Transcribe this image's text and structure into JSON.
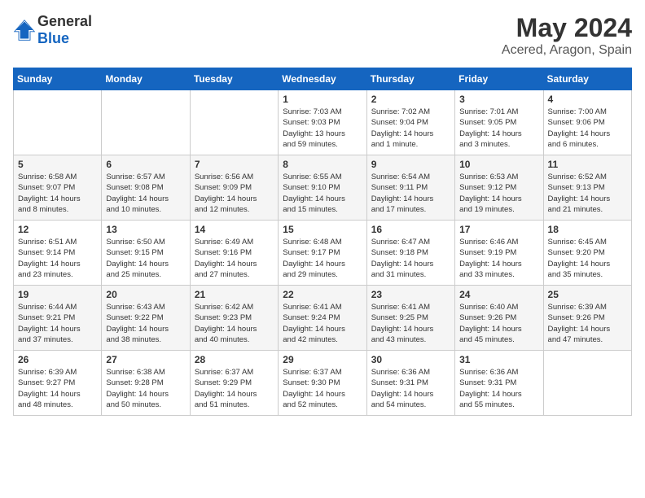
{
  "header": {
    "logo_general": "General",
    "logo_blue": "Blue",
    "month": "May 2024",
    "location": "Acered, Aragon, Spain"
  },
  "weekdays": [
    "Sunday",
    "Monday",
    "Tuesday",
    "Wednesday",
    "Thursday",
    "Friday",
    "Saturday"
  ],
  "weeks": [
    [
      {
        "day": "",
        "detail": ""
      },
      {
        "day": "",
        "detail": ""
      },
      {
        "day": "",
        "detail": ""
      },
      {
        "day": "1",
        "detail": "Sunrise: 7:03 AM\nSunset: 9:03 PM\nDaylight: 13 hours\nand 59 minutes."
      },
      {
        "day": "2",
        "detail": "Sunrise: 7:02 AM\nSunset: 9:04 PM\nDaylight: 14 hours\nand 1 minute."
      },
      {
        "day": "3",
        "detail": "Sunrise: 7:01 AM\nSunset: 9:05 PM\nDaylight: 14 hours\nand 3 minutes."
      },
      {
        "day": "4",
        "detail": "Sunrise: 7:00 AM\nSunset: 9:06 PM\nDaylight: 14 hours\nand 6 minutes."
      }
    ],
    [
      {
        "day": "5",
        "detail": "Sunrise: 6:58 AM\nSunset: 9:07 PM\nDaylight: 14 hours\nand 8 minutes."
      },
      {
        "day": "6",
        "detail": "Sunrise: 6:57 AM\nSunset: 9:08 PM\nDaylight: 14 hours\nand 10 minutes."
      },
      {
        "day": "7",
        "detail": "Sunrise: 6:56 AM\nSunset: 9:09 PM\nDaylight: 14 hours\nand 12 minutes."
      },
      {
        "day": "8",
        "detail": "Sunrise: 6:55 AM\nSunset: 9:10 PM\nDaylight: 14 hours\nand 15 minutes."
      },
      {
        "day": "9",
        "detail": "Sunrise: 6:54 AM\nSunset: 9:11 PM\nDaylight: 14 hours\nand 17 minutes."
      },
      {
        "day": "10",
        "detail": "Sunrise: 6:53 AM\nSunset: 9:12 PM\nDaylight: 14 hours\nand 19 minutes."
      },
      {
        "day": "11",
        "detail": "Sunrise: 6:52 AM\nSunset: 9:13 PM\nDaylight: 14 hours\nand 21 minutes."
      }
    ],
    [
      {
        "day": "12",
        "detail": "Sunrise: 6:51 AM\nSunset: 9:14 PM\nDaylight: 14 hours\nand 23 minutes."
      },
      {
        "day": "13",
        "detail": "Sunrise: 6:50 AM\nSunset: 9:15 PM\nDaylight: 14 hours\nand 25 minutes."
      },
      {
        "day": "14",
        "detail": "Sunrise: 6:49 AM\nSunset: 9:16 PM\nDaylight: 14 hours\nand 27 minutes."
      },
      {
        "day": "15",
        "detail": "Sunrise: 6:48 AM\nSunset: 9:17 PM\nDaylight: 14 hours\nand 29 minutes."
      },
      {
        "day": "16",
        "detail": "Sunrise: 6:47 AM\nSunset: 9:18 PM\nDaylight: 14 hours\nand 31 minutes."
      },
      {
        "day": "17",
        "detail": "Sunrise: 6:46 AM\nSunset: 9:19 PM\nDaylight: 14 hours\nand 33 minutes."
      },
      {
        "day": "18",
        "detail": "Sunrise: 6:45 AM\nSunset: 9:20 PM\nDaylight: 14 hours\nand 35 minutes."
      }
    ],
    [
      {
        "day": "19",
        "detail": "Sunrise: 6:44 AM\nSunset: 9:21 PM\nDaylight: 14 hours\nand 37 minutes."
      },
      {
        "day": "20",
        "detail": "Sunrise: 6:43 AM\nSunset: 9:22 PM\nDaylight: 14 hours\nand 38 minutes."
      },
      {
        "day": "21",
        "detail": "Sunrise: 6:42 AM\nSunset: 9:23 PM\nDaylight: 14 hours\nand 40 minutes."
      },
      {
        "day": "22",
        "detail": "Sunrise: 6:41 AM\nSunset: 9:24 PM\nDaylight: 14 hours\nand 42 minutes."
      },
      {
        "day": "23",
        "detail": "Sunrise: 6:41 AM\nSunset: 9:25 PM\nDaylight: 14 hours\nand 43 minutes."
      },
      {
        "day": "24",
        "detail": "Sunrise: 6:40 AM\nSunset: 9:26 PM\nDaylight: 14 hours\nand 45 minutes."
      },
      {
        "day": "25",
        "detail": "Sunrise: 6:39 AM\nSunset: 9:26 PM\nDaylight: 14 hours\nand 47 minutes."
      }
    ],
    [
      {
        "day": "26",
        "detail": "Sunrise: 6:39 AM\nSunset: 9:27 PM\nDaylight: 14 hours\nand 48 minutes."
      },
      {
        "day": "27",
        "detail": "Sunrise: 6:38 AM\nSunset: 9:28 PM\nDaylight: 14 hours\nand 50 minutes."
      },
      {
        "day": "28",
        "detail": "Sunrise: 6:37 AM\nSunset: 9:29 PM\nDaylight: 14 hours\nand 51 minutes."
      },
      {
        "day": "29",
        "detail": "Sunrise: 6:37 AM\nSunset: 9:30 PM\nDaylight: 14 hours\nand 52 minutes."
      },
      {
        "day": "30",
        "detail": "Sunrise: 6:36 AM\nSunset: 9:31 PM\nDaylight: 14 hours\nand 54 minutes."
      },
      {
        "day": "31",
        "detail": "Sunrise: 6:36 AM\nSunset: 9:31 PM\nDaylight: 14 hours\nand 55 minutes."
      },
      {
        "day": "",
        "detail": ""
      }
    ]
  ]
}
